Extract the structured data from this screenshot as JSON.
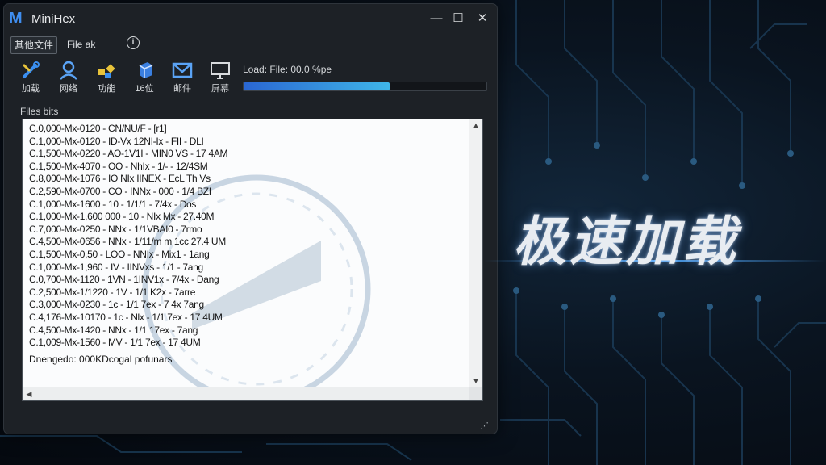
{
  "window": {
    "app_logo": "M",
    "title": "MiniHex"
  },
  "menu": {
    "items": [
      "其他文件",
      "File ak"
    ]
  },
  "toolbar": {
    "buttons": [
      {
        "label": "加载",
        "icon": "tools-icon"
      },
      {
        "label": "网络",
        "icon": "user-icon"
      },
      {
        "label": "功能",
        "icon": "puzzle-icon"
      },
      {
        "label": "16位",
        "icon": "cube-icon"
      },
      {
        "label": "邮件",
        "icon": "mail-icon"
      },
      {
        "label": "屏幕",
        "icon": "monitor-icon"
      }
    ]
  },
  "load": {
    "status": "Load: File: 00.0 %pe",
    "progress": 0.6
  },
  "files": {
    "section_label": "Files bits",
    "rows": [
      "C.0,000-Mx-0120 - CN/NU/F - [r1]",
      "C.1,000-Mx-0120 - ID-Vx 12NI-Ix - FII - DLI",
      "C.1,500-Mx-0220 - AO-1V1I - MIN0 VS - 17 4AM",
      "C.1,500-Mx-4070 - OO - NhIx - 1/- - 12/4SM",
      "C.8,000-Mx-1076 - IO NIx IINEX - EcL Th Vs",
      "C.2,590-Mx-0700 - CO - INNx - 000 - 1/4 BZI",
      "C.1,000-Mx-1600 - 10 - 1/1/1 - 7/4x - Dos",
      "C.1,000-Mx-1,600 000 - 10 - NIx Mx - 27.40M",
      "C.7,000-Mx-0250 - NNx - 1/1VBAI0 - 7rmo",
      "C.4,500-Mx-0656 - NNx - 1/11/m m 1cc 27.4 UM",
      "C.1,500-Mx-0,50 - LOO - NNIx - Mix1 - 1ang",
      "C.1,000-Mx-1,960 - IV - IINVxs - 1/1 - 7ang",
      "C.0,700-Mx-1120 - 1VN - 1INV1x - 7/4x - Dang",
      "C.2,500-Mx-1/1220 - 1V - 1/1 K2x - 7arre",
      "C.3,000-Mx-0230 - 1c - 1/1 7ex - 7 4x 7ang",
      "C.4,176-Mx-10170 - 1c - Nlx - 1/1 7ex - 17 4UM",
      "C.4,500-Mx-1420 - NNx - 1/1 17ex - 7ang",
      "C.1,009-Mx-1560 - MV - 1/1 7ex - 17 4UM"
    ],
    "footer": "Dnengedo: 000KDcogal pofunars"
  },
  "headline": "极速加载"
}
